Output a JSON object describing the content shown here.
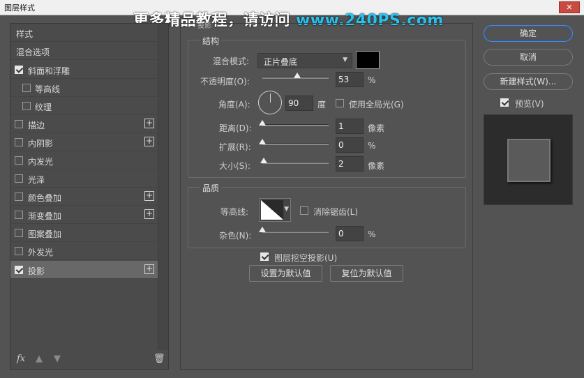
{
  "window": {
    "title": "图层样式",
    "close_icon": "close-icon"
  },
  "watermark": {
    "text": "更多精品教程，请访问",
    "url": "www.240PS.com"
  },
  "sidebar": {
    "items": [
      {
        "label": "样式",
        "checkbox": false,
        "checked": false,
        "plus": false,
        "selected": false
      },
      {
        "label": "混合选项",
        "checkbox": false,
        "checked": false,
        "plus": false,
        "selected": false
      },
      {
        "label": "斜面和浮雕",
        "checkbox": true,
        "checked": true,
        "plus": false,
        "selected": false
      },
      {
        "label": "等高线",
        "checkbox": true,
        "checked": false,
        "plus": false,
        "selected": false,
        "indent": true
      },
      {
        "label": "纹理",
        "checkbox": true,
        "checked": false,
        "plus": false,
        "selected": false,
        "indent": true
      },
      {
        "label": "描边",
        "checkbox": true,
        "checked": false,
        "plus": true,
        "selected": false
      },
      {
        "label": "内阴影",
        "checkbox": true,
        "checked": false,
        "plus": true,
        "selected": false
      },
      {
        "label": "内发光",
        "checkbox": true,
        "checked": false,
        "plus": false,
        "selected": false
      },
      {
        "label": "光泽",
        "checkbox": true,
        "checked": false,
        "plus": false,
        "selected": false
      },
      {
        "label": "颜色叠加",
        "checkbox": true,
        "checked": false,
        "plus": true,
        "selected": false
      },
      {
        "label": "渐变叠加",
        "checkbox": true,
        "checked": false,
        "plus": true,
        "selected": false
      },
      {
        "label": "图案叠加",
        "checkbox": true,
        "checked": false,
        "plus": false,
        "selected": false
      },
      {
        "label": "外发光",
        "checkbox": true,
        "checked": false,
        "plus": false,
        "selected": false
      },
      {
        "label": "投影",
        "checkbox": true,
        "checked": true,
        "plus": true,
        "selected": true
      }
    ],
    "footer": {
      "fx": "fx",
      "up_icon": "arrow-up-icon",
      "down_icon": "arrow-down-icon",
      "trash_icon": "trash-icon"
    }
  },
  "panel": {
    "section_label": "投影",
    "structure": {
      "title": "结构",
      "blend_mode_label": "混合模式:",
      "blend_mode_value": "正片叠底",
      "blend_color": "#000000",
      "opacity_label": "不透明度(O):",
      "opacity_value": "53",
      "opacity_unit": "%",
      "angle_label": "角度(A):",
      "angle_value": "90",
      "angle_unit": "度",
      "global_light_label": "使用全局光(G)",
      "global_light_checked": false,
      "distance_label": "距离(D):",
      "distance_value": "1",
      "distance_unit": "像素",
      "spread_label": "扩展(R):",
      "spread_value": "0",
      "spread_unit": "%",
      "size_label": "大小(S):",
      "size_value": "2",
      "size_unit": "像素"
    },
    "quality": {
      "title": "品质",
      "contour_label": "等高线:",
      "antialias_label": "消除锯齿(L)",
      "antialias_checked": false,
      "noise_label": "杂色(N):",
      "noise_value": "0",
      "noise_unit": "%"
    },
    "knockout_label": "图层挖空投影(U)",
    "knockout_checked": true,
    "set_default_label": "设置为默认值",
    "reset_default_label": "复位为默认值"
  },
  "right": {
    "ok_label": "确定",
    "cancel_label": "取消",
    "new_style_label": "新建样式(W)...",
    "preview_label": "预览(V)",
    "preview_checked": true
  }
}
